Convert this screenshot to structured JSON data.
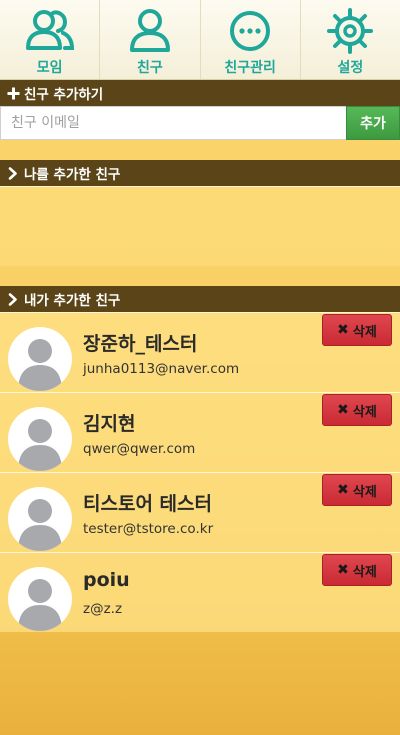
{
  "nav": {
    "tabs": [
      {
        "label": "모임",
        "icon": "group-icon"
      },
      {
        "label": "친구",
        "icon": "person-icon"
      },
      {
        "label": "친구관리",
        "icon": "more-circle-icon"
      },
      {
        "label": "설정",
        "icon": "gear-icon"
      }
    ]
  },
  "add_friend": {
    "title": "친구 추가하기",
    "placeholder": "친구 이메일",
    "button_label": "추가"
  },
  "added_me": {
    "title": "나를 추가한 친구"
  },
  "my_friends": {
    "title": "내가 추가한 친구",
    "delete_label": "삭제",
    "items": [
      {
        "name": "장준하_테스터",
        "email": "junha0113@naver.com"
      },
      {
        "name": "김지현",
        "email": "qwer@qwer.com"
      },
      {
        "name": "티스토어 테스터",
        "email": "tester@tstore.co.kr"
      },
      {
        "name": "poiu",
        "email": "z@z.z"
      }
    ]
  },
  "colors": {
    "accent": "#1fa89a",
    "section_bar": "#5a4418",
    "add_button": "#4aa94c",
    "delete_button": "#d63a42"
  }
}
